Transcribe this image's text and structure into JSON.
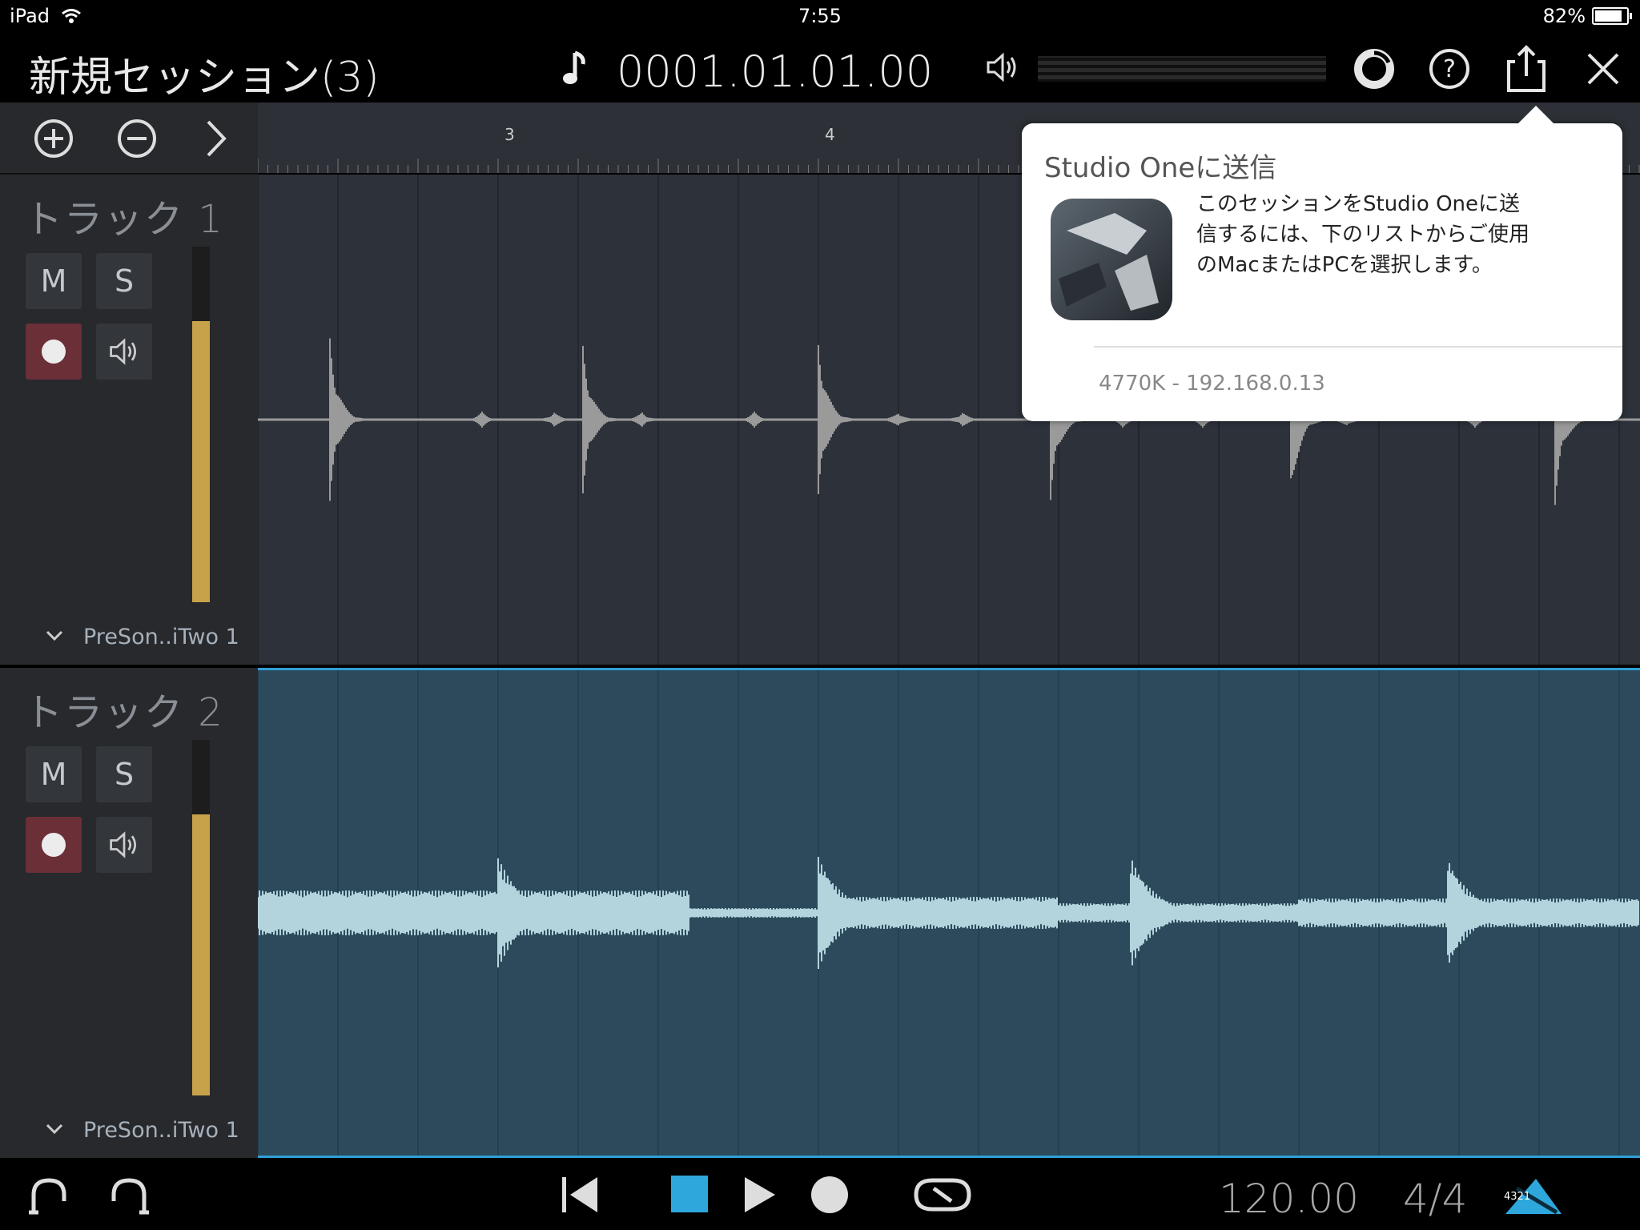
{
  "status": {
    "device": "iPad",
    "time": "7:55",
    "battery": "82%"
  },
  "header": {
    "title": "新規セッション(3)",
    "position": "0001.01.01.00"
  },
  "ruler": {
    "labels": [
      "3",
      "4"
    ]
  },
  "tracks": [
    {
      "name": "トラック 1",
      "mute": "M",
      "solo": "S",
      "input": "PreSon..iTwo 1",
      "level": 0.79,
      "selected": false
    },
    {
      "name": "トラック 2",
      "mute": "M",
      "solo": "S",
      "input": "PreSon..iTwo 1",
      "level": 0.79,
      "selected": true
    }
  ],
  "popover": {
    "title": "Studio Oneに送信",
    "message": "このセッションをStudio Oneに送信するには、下のリストからご使用のMacまたはPCを選択します。",
    "devices": [
      "4770K - 192.168.0.13"
    ]
  },
  "transport": {
    "tempo": "120.00",
    "time_signature": "4/4",
    "badge": "4321"
  },
  "colors": {
    "accent": "#2fa0d6",
    "record": "#6b2f38",
    "meter": "#c8a24a",
    "wave_selected": "#b3d3dd",
    "wave_normal": "#9a9a9a"
  },
  "icons": [
    "note-icon",
    "volume-icon",
    "spinner-icon",
    "help-icon",
    "share-icon",
    "close-icon",
    "add-icon",
    "remove-icon",
    "expand-icon",
    "chevron-down-icon",
    "record-arm-icon",
    "monitor-icon",
    "loop-start-icon",
    "loop-end-icon",
    "rewind-icon",
    "stop-icon",
    "play-icon",
    "record-icon",
    "loop-icon",
    "metronome-icon"
  ]
}
